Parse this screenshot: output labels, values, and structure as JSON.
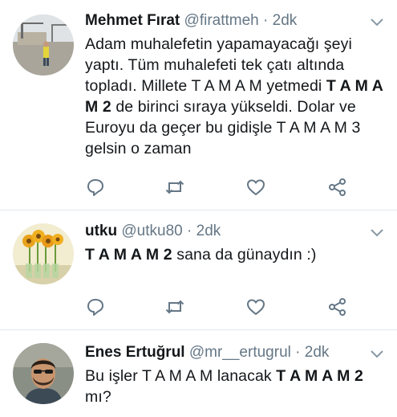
{
  "colors": {
    "text": "#14171a",
    "secondary": "#657786",
    "divider": "#e1e8ed",
    "icon": "#657786"
  },
  "tweets": [
    {
      "name": "Mehmet Fırat",
      "handle": "@firattmeh",
      "separator": "·",
      "time": "2dk",
      "text_parts": [
        "Adam muhalefetin yapamayacağı şeyi yaptı.  Tüm muhalefeti tek çatı altında topladı. Millete T A M A M yetmedi ",
        "T A M A M 2",
        " de birinci sıraya yükseldi. Dolar ve Euroyu da geçer bu gidişle T A M A M 3 gelsin o zaman"
      ],
      "actions": [
        "reply-icon",
        "retweet-icon",
        "like-icon",
        "share-icon"
      ]
    },
    {
      "name": "utku",
      "handle": "@utku80",
      "separator": "·",
      "time": "2dk",
      "text_parts": [
        "T A M A M 2",
        " sana da günaydın :)"
      ],
      "actions": [
        "reply-icon",
        "retweet-icon",
        "like-icon",
        "share-icon"
      ]
    },
    {
      "name": "Enes Ertuğrul",
      "handle": "@mr__ertugrul",
      "separator": "·",
      "time": "2dk",
      "text_parts": [
        "Bu işler T A M A M lanacak ",
        "T A M A M 2",
        " mı?"
      ]
    }
  ]
}
